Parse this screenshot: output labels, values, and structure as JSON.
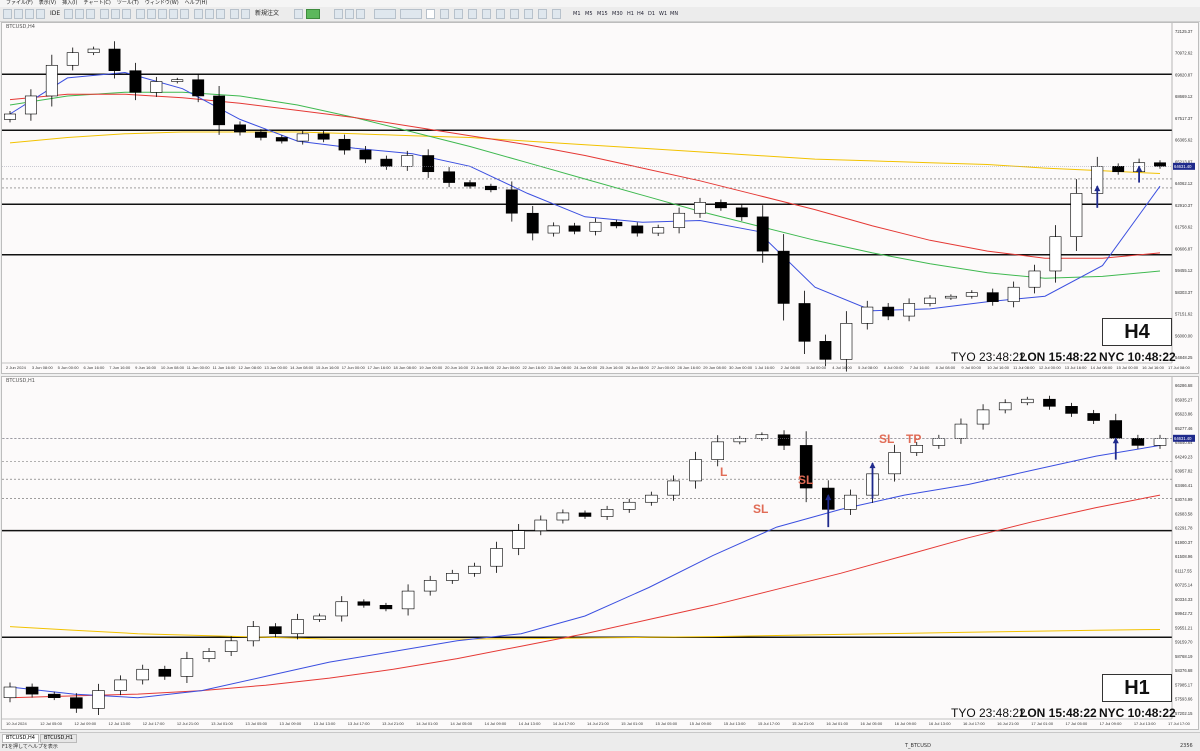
{
  "menu": [
    "ファイル(F)",
    "表示(V)",
    "挿入(I)",
    "チャート(C)",
    "ツール(T)",
    "ウィンドウ(W)",
    "ヘルプ(H)"
  ],
  "toolbar": {
    "autotrade_label": "アルゴリズム取引",
    "ide_label": "IDE",
    "neworder_label": "新規注文",
    "timeframes": [
      "M1",
      "M5",
      "M15",
      "M30",
      "H1",
      "H4",
      "D1",
      "W1",
      "MN"
    ]
  },
  "windows": {
    "top": {
      "title": "BTCUSD,H4",
      "tf_label": "H4",
      "clock": {
        "tyo": "TYO 23:48:22",
        "lon": "LON 15:48:22",
        "nyc": "NYC 10:48:22"
      },
      "price_labels": [
        "72125.37",
        "70972.62",
        "69820.87",
        "68669.12",
        "67517.37",
        "66365.62",
        "65213.87",
        "64062.12",
        "62910.37",
        "61758.62",
        "60606.87",
        "59455.12",
        "58303.37",
        "57151.62",
        "56000.00",
        "54848.25"
      ],
      "current_price": "64631.40",
      "time_labels": [
        "2 Jun 2024",
        "3 Jun 08:00",
        "5 Jun 00:00",
        "6 Jun 16:00",
        "7 Jun 16:00",
        "9 Jun 16:00",
        "10 Jun 08:00",
        "11 Jun 00:00",
        "11 Jun 16:00",
        "12 Jun 08:00",
        "13 Jun 00:00",
        "14 Jun 08:00",
        "15 Jun 16:00",
        "17 Jun 00:00",
        "17 Jun 16:00",
        "18 Jun 08:00",
        "19 Jun 00:00",
        "20 Jun 16:00",
        "21 Jun 08:00",
        "22 Jun 00:00",
        "22 Jun 16:00",
        "23 Jun 08:00",
        "24 Jun 00:00",
        "25 Jun 16:00",
        "26 Jun 08:00",
        "27 Jun 00:00",
        "28 Jun 16:00",
        "29 Jun 08:00",
        "30 Jun 00:00",
        "1 Jul 16:00",
        "2 Jul 08:00",
        "3 Jul 00:00",
        "4 Jul 16:00",
        "5 Jul 08:00",
        "6 Jul 00:00",
        "7 Jul 16:00",
        "8 Jul 08:00",
        "9 Jul 00:00",
        "10 Jul 16:00",
        "11 Jul 08:00",
        "12 Jul 00:00",
        "13 Jul 16:00",
        "14 Jul 08:00",
        "15 Jul 00:00",
        "16 Jul 16:00",
        "17 Jul 08:00"
      ]
    },
    "bottom": {
      "title": "BTCUSD,H1",
      "tf_label": "H1",
      "clock": {
        "tyo": "TYO 23:48:22",
        "lon": "LON 15:48:22",
        "nyc": "NYC 10:48:22"
      },
      "price_labels": [
        "66286.68",
        "65935.27",
        "65623.86",
        "65277.46",
        "64640.64",
        "64249.23",
        "63957.82",
        "63466.41",
        "63074.99",
        "62683.58",
        "62291.78",
        "61900.37",
        "61508.96",
        "61117.55",
        "60725.14",
        "60334.33",
        "59942.72",
        "59551.21",
        "59159.70",
        "58768.19",
        "58376.68",
        "57985.17",
        "57593.66",
        "57202.15"
      ],
      "current_price": "64631.40",
      "annotations": {
        "sl1": "SL",
        "sl2": "SL",
        "sl3": "SL",
        "tp": "TP",
        "l": "L"
      },
      "time_labels": [
        "10 Jul 2024",
        "12 Jul 05:00",
        "12 Jul 09:00",
        "12 Jul 13:00",
        "12 Jul 17:00",
        "12 Jul 21:00",
        "13 Jul 01:00",
        "13 Jul 05:00",
        "13 Jul 09:00",
        "13 Jul 13:00",
        "13 Jul 17:00",
        "13 Jul 21:00",
        "14 Jul 01:00",
        "14 Jul 05:00",
        "14 Jul 09:00",
        "14 Jul 13:00",
        "14 Jul 17:00",
        "14 Jul 21:00",
        "15 Jul 01:00",
        "15 Jul 05:00",
        "15 Jul 09:00",
        "15 Jul 13:00",
        "15 Jul 17:00",
        "15 Jul 21:00",
        "16 Jul 01:00",
        "16 Jul 05:00",
        "16 Jul 09:00",
        "16 Jul 13:00",
        "16 Jul 17:00",
        "16 Jul 21:00",
        "17 Jul 01:00",
        "17 Jul 05:00",
        "17 Jul 09:00",
        "17 Jul 13:00",
        "17 Jul 17:00"
      ]
    }
  },
  "tabs": [
    "BTCUSD,H4",
    "BTCUSD,H1"
  ],
  "status": {
    "help": "F1を押してヘルプを表示",
    "symbol": "T_BTCUSD",
    "size": "2356"
  },
  "colors": {
    "bull_fill": "#ffffff",
    "bear_fill": "#000000",
    "ma_blue": "#3b4fe0",
    "ma_green": "#3fb950",
    "ma_red": "#e53935",
    "ma_yellow": "#f2c200",
    "arrow": "#1f2a8c",
    "label_orange": "#e06b55"
  },
  "chart_data": [
    {
      "type": "candlestick",
      "symbol": "BTCUSD",
      "timeframe": "H4",
      "period": [
        "2 Jun 2024",
        "17 Jul 16:00"
      ],
      "ylim": [
        54000,
        72400
      ],
      "approx_close_path": [
        67800,
        68800,
        70500,
        71200,
        71400,
        70200,
        69000,
        69600,
        69700,
        68800,
        67200,
        66800,
        66500,
        66300,
        66700,
        66400,
        65800,
        65300,
        64900,
        65500,
        64600,
        64000,
        63800,
        63600,
        62300,
        61200,
        61600,
        61300,
        61800,
        61600,
        61200,
        61500,
        62300,
        62900,
        62600,
        62100,
        60200,
        57300,
        55200,
        54200,
        56200,
        57100,
        56600,
        57300,
        57600,
        57700,
        57900,
        57400,
        58200,
        59100,
        61000,
        63400,
        64900,
        64600,
        65100,
        64900
      ]
    },
    {
      "type": "candlestick",
      "symbol": "BTCUSD",
      "timeframe": "H1",
      "period": [
        "10 Jul 2024",
        "17 Jul 17:00"
      ],
      "ylim": [
        57000,
        66400
      ],
      "approx_close_path": [
        57900,
        57700,
        57600,
        57300,
        57800,
        58100,
        58400,
        58200,
        58700,
        58900,
        59200,
        59600,
        59400,
        59800,
        59900,
        60300,
        60200,
        60100,
        60600,
        60900,
        61100,
        61300,
        61800,
        62300,
        62600,
        62800,
        62700,
        62900,
        63100,
        63300,
        63700,
        64300,
        64800,
        64900,
        65000,
        64700,
        63500,
        62900,
        63300,
        63900,
        64500,
        64700,
        64900,
        65300,
        65700,
        65900,
        66000,
        65800,
        65600,
        65400,
        64900,
        64700,
        64900
      ]
    }
  ]
}
